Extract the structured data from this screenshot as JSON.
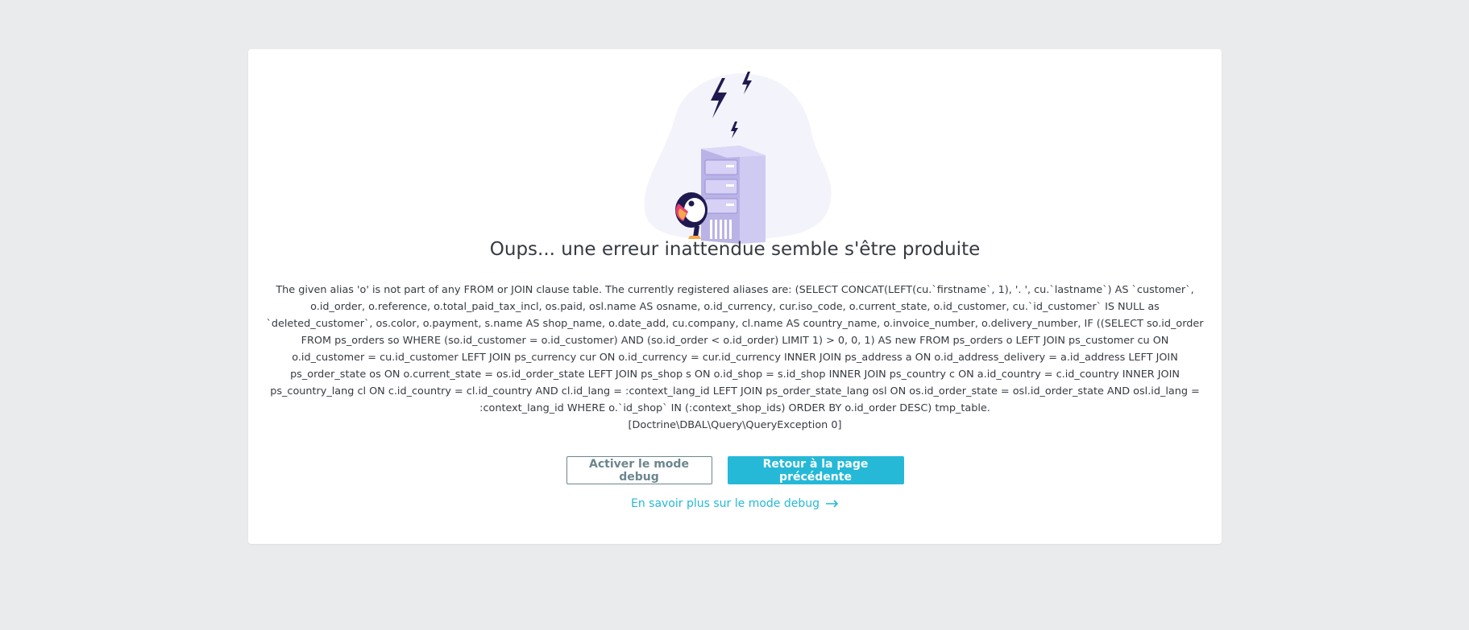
{
  "error": {
    "title": "Oups... une erreur inattendue semble s'être produite",
    "message": "The given alias 'o' is not part of any FROM or JOIN clause table. The currently registered aliases are: (SELECT CONCAT(LEFT(cu.`firstname`, 1), '. ', cu.`lastname`) AS `customer`, o.id_order, o.reference, o.total_paid_tax_incl, os.paid, osl.name AS osname, o.id_currency, cur.iso_code, o.current_state, o.id_customer, cu.`id_customer` IS NULL as `deleted_customer`, os.color, o.payment, s.name AS shop_name, o.date_add, cu.company, cl.name AS country_name, o.invoice_number, o.delivery_number, IF ((SELECT so.id_order FROM ps_orders so WHERE (so.id_customer = o.id_customer) AND (so.id_order < o.id_order) LIMIT 1) > 0, 0, 1) AS new FROM ps_orders o LEFT JOIN ps_customer cu ON o.id_customer = cu.id_customer LEFT JOIN ps_currency cur ON o.id_currency = cur.id_currency INNER JOIN ps_address a ON o.id_address_delivery = a.id_address LEFT JOIN ps_order_state os ON o.current_state = os.id_order_state LEFT JOIN ps_shop s ON o.id_shop = s.id_shop INNER JOIN ps_country c ON a.id_country = c.id_country INNER JOIN ps_country_lang cl ON c.id_country = cl.id_country AND cl.id_lang = :context_lang_id LEFT JOIN ps_order_state_lang osl ON os.id_order_state = osl.id_order_state AND osl.id_lang = :context_lang_id WHERE o.`id_shop` IN (:context_shop_ids) ORDER BY o.id_order DESC) tmp_table.",
    "exception": "[Doctrine\\DBAL\\Query\\QueryException 0]"
  },
  "actions": {
    "debug_button_label": "Activer le mode debug",
    "back_button_label": "Retour à la page précédente",
    "learn_more_link": "En savoir plus sur le mode debug"
  },
  "icons": {
    "illustration": "server-error-puffin-illustration",
    "link_arrow": "arrow-right-icon"
  },
  "colors": {
    "primary": "#25b9d7",
    "secondary": "#6c868e",
    "text": "#363a41",
    "background": "#eaebec"
  }
}
